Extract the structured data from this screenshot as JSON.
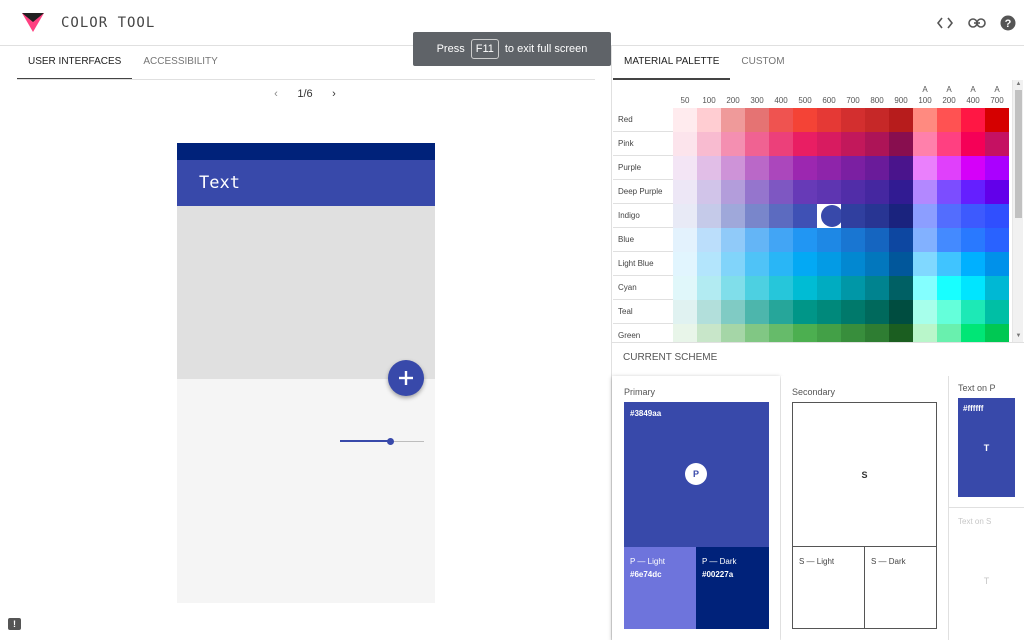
{
  "app": {
    "title": "COLOR TOOL",
    "icons": [
      "code-icon",
      "link-icon",
      "help-icon"
    ]
  },
  "left_tabs": [
    {
      "label": "USER INTERFACES",
      "active": true
    },
    {
      "label": "ACCESSIBILITY",
      "active": false
    }
  ],
  "right_tabs": [
    {
      "label": "MATERIAL PALETTE",
      "active": true
    },
    {
      "label": "CUSTOM",
      "active": false
    }
  ],
  "pager": {
    "label": "1/6"
  },
  "fullscreen_notice": {
    "before": "Press",
    "key": "F11",
    "after": "to exit full screen"
  },
  "preview": {
    "appbar_title": "Text",
    "fab_symbol": "+",
    "slider_value": 0.6,
    "colors": {
      "primary": "#3849aa",
      "dark": "#00227a",
      "content": "#e0e0e0",
      "background": "#f5f5f5"
    }
  },
  "palette": {
    "shades": [
      "50",
      "100",
      "200",
      "300",
      "400",
      "500",
      "600",
      "700",
      "800",
      "900",
      "A100",
      "A200",
      "A400",
      "A700"
    ],
    "selected": {
      "hue": "Indigo",
      "shade": "600"
    },
    "rows": [
      {
        "name": "Red",
        "colors": [
          "#ffebee",
          "#ffcdd2",
          "#ef9a9a",
          "#e57373",
          "#ef5350",
          "#f44336",
          "#e53935",
          "#d32f2f",
          "#c62828",
          "#b71c1c",
          "#ff8a80",
          "#ff5252",
          "#ff1744",
          "#d50000"
        ]
      },
      {
        "name": "Pink",
        "colors": [
          "#fce4ec",
          "#f8bbd0",
          "#f48fb1",
          "#f06292",
          "#ec407a",
          "#e91e63",
          "#d81b60",
          "#c2185b",
          "#ad1457",
          "#880e4f",
          "#ff80ab",
          "#ff4081",
          "#f50057",
          "#c51162"
        ]
      },
      {
        "name": "Purple",
        "colors": [
          "#f3e5f5",
          "#e1bee7",
          "#ce93d8",
          "#ba68c8",
          "#ab47bc",
          "#9c27b0",
          "#8e24aa",
          "#7b1fa2",
          "#6a1b9a",
          "#4a148c",
          "#ea80fc",
          "#e040fb",
          "#d500f9",
          "#aa00ff"
        ]
      },
      {
        "name": "Deep Purple",
        "colors": [
          "#ede7f6",
          "#d1c4e9",
          "#b39ddb",
          "#9575cd",
          "#7e57c2",
          "#673ab7",
          "#5e35b1",
          "#512da8",
          "#4527a0",
          "#311b92",
          "#b388ff",
          "#7c4dff",
          "#651fff",
          "#6200ea"
        ]
      },
      {
        "name": "Indigo",
        "colors": [
          "#e8eaf6",
          "#c5cae9",
          "#9fa8da",
          "#7986cb",
          "#5c6bc0",
          "#3f51b5",
          "#3949ab",
          "#303f9f",
          "#283593",
          "#1a237e",
          "#8c9eff",
          "#536dfe",
          "#3d5afe",
          "#304ffe"
        ]
      },
      {
        "name": "Blue",
        "colors": [
          "#e3f2fd",
          "#bbdefb",
          "#90caf9",
          "#64b5f6",
          "#42a5f5",
          "#2196f3",
          "#1e88e5",
          "#1976d2",
          "#1565c0",
          "#0d47a1",
          "#82b1ff",
          "#448aff",
          "#2979ff",
          "#2962ff"
        ]
      },
      {
        "name": "Light Blue",
        "colors": [
          "#e1f5fe",
          "#b3e5fc",
          "#81d4fa",
          "#4fc3f7",
          "#29b6f6",
          "#03a9f4",
          "#039be5",
          "#0288d1",
          "#0277bd",
          "#01579b",
          "#80d8ff",
          "#40c4ff",
          "#00b0ff",
          "#0091ea"
        ]
      },
      {
        "name": "Cyan",
        "colors": [
          "#e0f7fa",
          "#b2ebf2",
          "#80deea",
          "#4dd0e1",
          "#26c6da",
          "#00bcd4",
          "#00acc1",
          "#0097a7",
          "#00838f",
          "#006064",
          "#84ffff",
          "#18ffff",
          "#00e5ff",
          "#00b8d4"
        ]
      },
      {
        "name": "Teal",
        "colors": [
          "#e0f2f1",
          "#b2dfdb",
          "#80cbc4",
          "#4db6ac",
          "#26a69a",
          "#009688",
          "#00897b",
          "#00796b",
          "#00695c",
          "#004d40",
          "#a7ffeb",
          "#64ffda",
          "#1de9b6",
          "#00bfa5"
        ]
      },
      {
        "name": "Green",
        "colors": [
          "#e8f5e9",
          "#c8e6c9",
          "#a5d6a7",
          "#81c784",
          "#66bb6a",
          "#4caf50",
          "#43a047",
          "#388e3c",
          "#2e7d32",
          "#1b5e20",
          "#b9f6ca",
          "#69f0ae",
          "#00e676",
          "#00c853"
        ]
      }
    ]
  },
  "scheme": {
    "title": "CURRENT SCHEME",
    "primary": {
      "label": "Primary",
      "hex": "#3849aa",
      "letter": "P",
      "light_label": "P — Light",
      "light_hex": "#6e74dc",
      "dark_label": "P — Dark",
      "dark_hex": "#00227a"
    },
    "secondary": {
      "label": "Secondary",
      "letter": "S",
      "light_label": "S — Light",
      "dark_label": "S — Dark"
    },
    "text_on_p": {
      "label": "Text on P",
      "hex": "#ffffff",
      "letter": "T"
    },
    "text_on_s": {
      "label": "Text on S",
      "letter": "T"
    }
  }
}
